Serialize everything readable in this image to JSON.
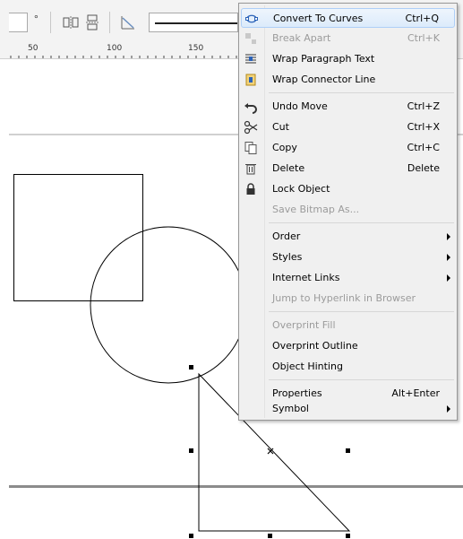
{
  "toolbar": {
    "angle_value": "",
    "degree_symbol": "°"
  },
  "ruler": {
    "labels": [
      "50",
      "100",
      "150"
    ]
  },
  "context_menu": {
    "items": [
      {
        "label": "Convert To Curves",
        "shortcut": "Ctrl+Q",
        "icon": "convert-to-curves-icon",
        "enabled": true
      },
      {
        "label": "Break Apart",
        "shortcut": "Ctrl+K",
        "icon": "break-apart-icon",
        "enabled": false
      },
      {
        "label": "Wrap Paragraph Text",
        "shortcut": "",
        "icon": "wrap-paragraph-text-icon",
        "enabled": true
      },
      {
        "label": "Wrap Connector Line",
        "shortcut": "",
        "icon": "wrap-connector-line-icon",
        "enabled": true
      },
      {
        "label": "Undo Move",
        "shortcut": "Ctrl+Z",
        "icon": "undo-icon",
        "enabled": true
      },
      {
        "label": "Cut",
        "shortcut": "Ctrl+X",
        "icon": "scissors-icon",
        "enabled": true
      },
      {
        "label": "Copy",
        "shortcut": "Ctrl+C",
        "icon": "copy-icon",
        "enabled": true
      },
      {
        "label": "Delete",
        "shortcut": "Delete",
        "icon": "trash-icon",
        "enabled": true
      },
      {
        "label": "Lock Object",
        "shortcut": "",
        "icon": "lock-icon",
        "enabled": true
      },
      {
        "label": "Save Bitmap As...",
        "shortcut": "",
        "icon": "",
        "enabled": false
      },
      {
        "label": "Order",
        "shortcut": "",
        "icon": "",
        "enabled": true,
        "submenu": true
      },
      {
        "label": "Styles",
        "shortcut": "",
        "icon": "",
        "enabled": true,
        "submenu": true
      },
      {
        "label": "Internet Links",
        "shortcut": "",
        "icon": "",
        "enabled": true,
        "submenu": true
      },
      {
        "label": "Jump to Hyperlink in Browser",
        "shortcut": "",
        "icon": "",
        "enabled": false
      },
      {
        "label": "Overprint Fill",
        "shortcut": "",
        "icon": "",
        "enabled": false
      },
      {
        "label": "Overprint Outline",
        "shortcut": "",
        "icon": "",
        "enabled": true
      },
      {
        "label": "Object Hinting",
        "shortcut": "",
        "icon": "",
        "enabled": true
      },
      {
        "label": "Properties",
        "shortcut": "Alt+Enter",
        "icon": "",
        "enabled": true
      },
      {
        "label": "Symbol",
        "shortcut": "",
        "icon": "",
        "enabled": true,
        "submenu": true
      }
    ]
  }
}
